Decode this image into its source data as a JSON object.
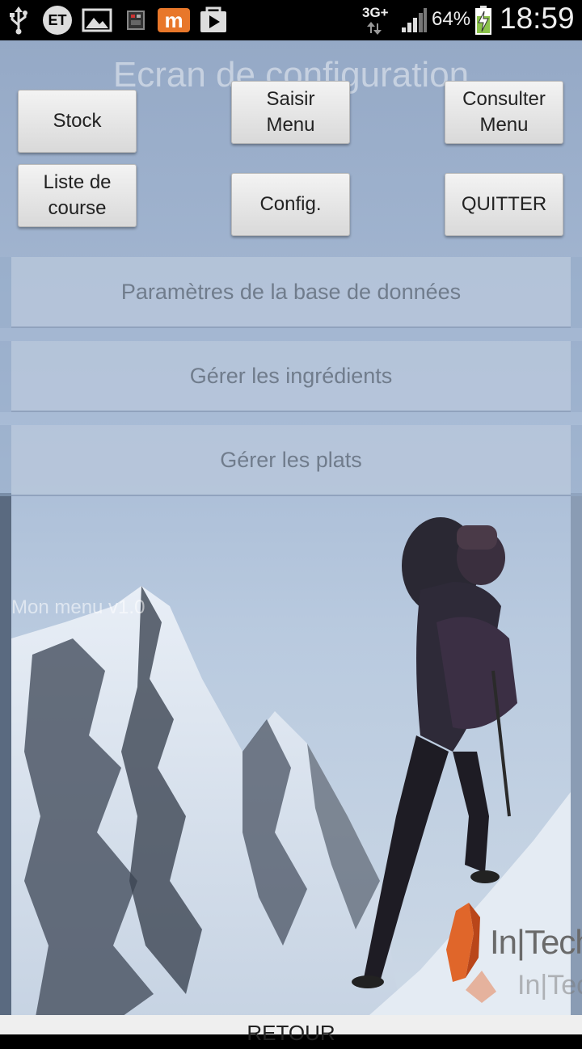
{
  "status_bar": {
    "left_icons": [
      "usb-icon",
      "et-icon",
      "gallery-icon",
      "app-icon",
      "m-app-icon",
      "play-store-icon"
    ],
    "et_label": "ET",
    "m_label": "m",
    "network": "3G+",
    "battery": "64%",
    "time": "18:59"
  },
  "screen": {
    "title": "Ecran de configuration",
    "buttons": {
      "stock": "Stock",
      "saisir_menu": "Saisir\nMenu",
      "consulter_menu": "Consulter\nMenu",
      "liste_course": "Liste de\ncourse",
      "config": "Config.",
      "quitter": "QUITTER"
    },
    "panels": [
      {
        "label": "Paramètres de la base de données"
      },
      {
        "label": "Gérer les ingrédients"
      },
      {
        "label": "Gérer les plats"
      }
    ],
    "version": "Mon menu v1.0",
    "logo_text": "In|Tech",
    "back_button": "RETOUR"
  },
  "colors": {
    "accent_logo": "#e0662a",
    "panel_text": "#707c8c"
  }
}
